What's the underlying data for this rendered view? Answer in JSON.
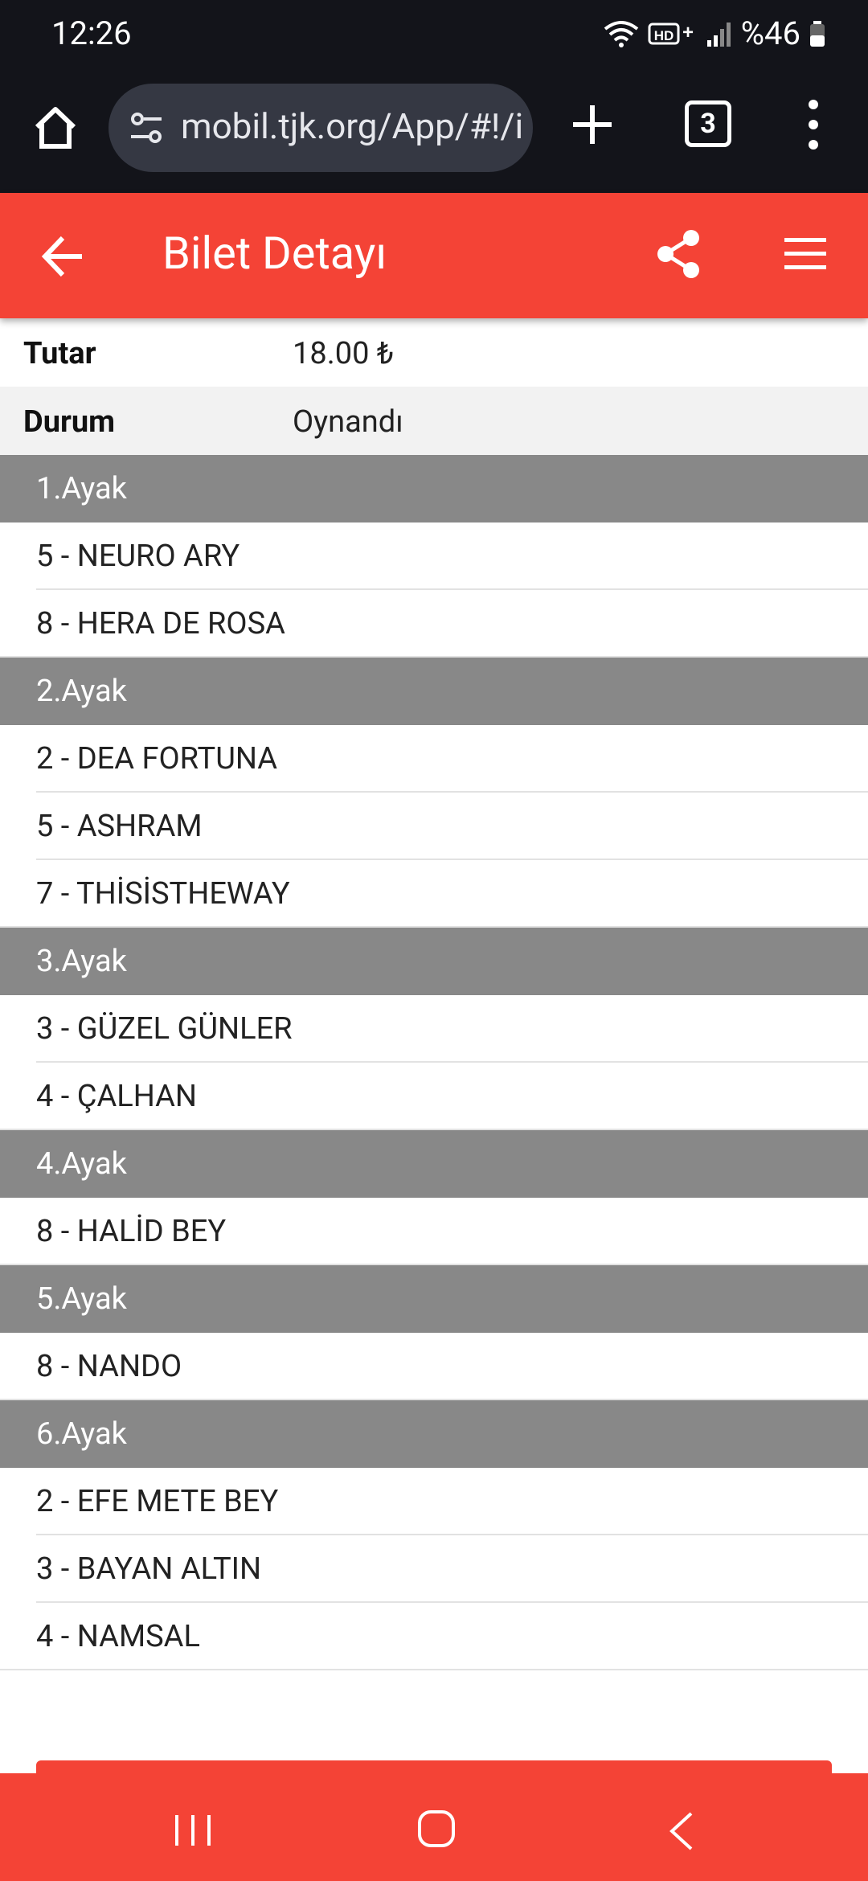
{
  "status_bar": {
    "time": "12:26",
    "battery": "%46"
  },
  "browser": {
    "url": "mobil.tjk.org/App/#!/i",
    "tab_count": "3"
  },
  "header": {
    "title": "Bilet Detayı"
  },
  "info": [
    {
      "key": "Tutar",
      "value": "18.00 ₺"
    },
    {
      "key": "Durum",
      "value": "Oynandı"
    }
  ],
  "legs": [
    {
      "label": "1.Ayak",
      "horses": [
        "5 - NEURO ARY",
        "8 - HERA DE ROSA"
      ]
    },
    {
      "label": "2.Ayak",
      "horses": [
        "2 - DEA FORTUNA",
        "5 - ASHRAM",
        "7 - THİSİSTHEWAY"
      ]
    },
    {
      "label": "3.Ayak",
      "horses": [
        "3 - GÜZEL GÜNLER",
        "4 - ÇALHAN"
      ]
    },
    {
      "label": "4.Ayak",
      "horses": [
        "8 - HALİD BEY"
      ]
    },
    {
      "label": "5.Ayak",
      "horses": [
        "8 - NANDO"
      ]
    },
    {
      "label": "6.Ayak",
      "horses": [
        "2 - EFE METE BEY",
        "3 - BAYAN ALTIN",
        "4 - NAMSAL"
      ]
    }
  ],
  "colors": {
    "accent": "#f44336",
    "leg_header": "#888888",
    "status_bg": "#13141a"
  }
}
